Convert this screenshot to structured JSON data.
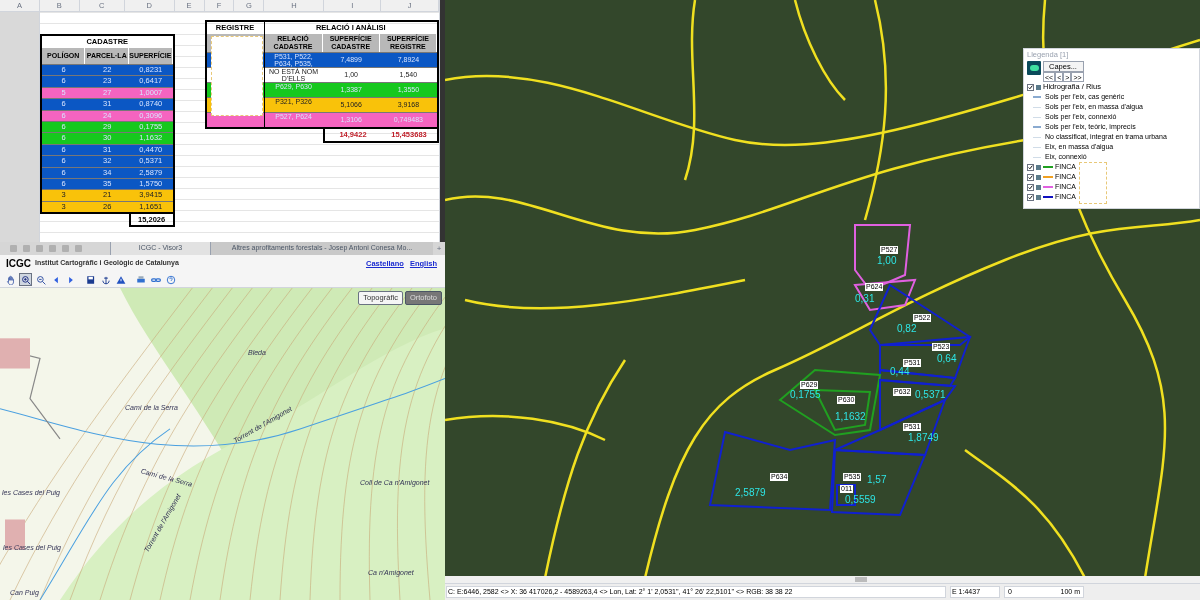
{
  "spreadsheet": {
    "columns": [
      "A",
      "B",
      "C",
      "D",
      "E",
      "F",
      "G",
      "H",
      "I",
      "J"
    ],
    "cadastre": {
      "title": "CADASTRE",
      "headers": [
        "POLÍGON",
        "PARCEL·LA",
        "SUPERFÍCIE"
      ],
      "rows": [
        {
          "poligon": "6",
          "parcela": "22",
          "superficie": "0,8231",
          "color": "#0b57c4"
        },
        {
          "poligon": "6",
          "parcela": "23",
          "superficie": "0,6417",
          "color": "#0b57c4"
        },
        {
          "poligon": "5",
          "parcela": "27",
          "superficie": "1,0007",
          "color": "#f564c0"
        },
        {
          "poligon": "6",
          "parcela": "31",
          "superficie": "0,8740",
          "color": "#0b57c4"
        },
        {
          "poligon": "6",
          "parcela": "24",
          "superficie": "0,3096",
          "color": "#f564c0"
        },
        {
          "poligon": "6",
          "parcela": "29",
          "superficie": "0,1755",
          "color": "#16c81e"
        },
        {
          "poligon": "6",
          "parcela": "30",
          "superficie": "1,1632",
          "color": "#16c81e"
        },
        {
          "poligon": "6",
          "parcela": "31",
          "superficie": "0,4470",
          "color": "#0b57c4"
        },
        {
          "poligon": "6",
          "parcela": "32",
          "superficie": "0,5371",
          "color": "#0b57c4"
        },
        {
          "poligon": "6",
          "parcela": "34",
          "superficie": "2,5879",
          "color": "#0b57c4"
        },
        {
          "poligon": "6",
          "parcela": "35",
          "superficie": "1,5750",
          "color": "#0b57c4"
        },
        {
          "poligon": "3",
          "parcela": "21",
          "superficie": "3,9415",
          "color": "#f9c20a"
        },
        {
          "poligon": "3",
          "parcela": "26",
          "superficie": "1,1651",
          "color": "#f9c20a"
        }
      ],
      "total": "15,2026"
    },
    "registre": {
      "title": "REGISTRE"
    },
    "relacio": {
      "title": "RELACIÓ I ANÀLISI",
      "headers": [
        "RELACIÓ CADASTRE",
        "SUPERFÍCIE CADASTRE",
        "SUPERFÍCIE REGISTRE"
      ],
      "rows": [
        {
          "relacio": "P531, P522, P634, P535,",
          "cadastre": "7,4899",
          "registre": "7,8924",
          "color": "#0b57c4"
        },
        {
          "relacio": "NO ESTÀ NOM D'ELLS",
          "cadastre": "1,00",
          "registre": "1,540",
          "color": "#ffffff"
        },
        {
          "relacio": "P629, P630",
          "cadastre": "1,3387",
          "registre": "1,3550",
          "color": "#16c81e"
        },
        {
          "relacio": "P321, P326",
          "cadastre": "5,1066",
          "registre": "3,9168",
          "color": "#f9c20a"
        },
        {
          "relacio": "P527, P624",
          "cadastre": "1,3106",
          "registre": "0,749483",
          "color": "#f564c0"
        }
      ],
      "totals": [
        "14,9422",
        "15,453683"
      ]
    }
  },
  "browser": {
    "tabs": [
      {
        "label": "ICGC - Visor3",
        "selected": true
      },
      {
        "label": "Altres aprofitaments forestals - Josep Antoni Conesa Mo...",
        "selected": false
      }
    ],
    "new_tab": "+",
    "site": {
      "logo": "ICGC",
      "name": "Institut Cartogràfic i Geològic de Catalunya",
      "links": [
        "Castellano",
        "English"
      ]
    },
    "toolbar": [
      {
        "selected": false
      },
      {
        "selected": true
      },
      {
        "selected": false
      },
      {
        "selected": false
      },
      {
        "selected": false
      },
      {
        "selected": false
      },
      {
        "selected": false
      },
      {
        "selected": false
      },
      {
        "selected": false
      },
      {
        "selected": false
      },
      {
        "selected": false
      }
    ],
    "map_modes": [
      {
        "label": "Topogràfic",
        "selected": true
      },
      {
        "label": "Ortofoto",
        "selected": false
      }
    ],
    "map_labels": [
      "Bleda",
      "Torrent de l'Amigonet",
      "Camí de la Serra",
      "Camí de la Serra",
      "Torrent de l'Amigonet",
      "Coll de Ca n'Amigonet",
      "Ca n'Amigonet",
      "les Cases del Puig",
      "les Cases del Puig",
      "Can Puig"
    ]
  },
  "gis": {
    "parcels": [
      {
        "code": "P527",
        "area": "1,00",
        "color": "#e060e0"
      },
      {
        "code": "P624",
        "area": "0,31",
        "color": "#e060e0"
      },
      {
        "code": "P522",
        "area": "0,82",
        "color": "#1020d0"
      },
      {
        "code": "P523",
        "area": "0,64",
        "color": "#1020d0"
      },
      {
        "code": "P531",
        "area": "0,44",
        "color": "#1020d0"
      },
      {
        "code": "P629",
        "area": "0,1755",
        "color": "#20a020"
      },
      {
        "code": "P630",
        "area": "1,1632",
        "color": "#20a020"
      },
      {
        "code": "P632",
        "area": "0,5371",
        "color": "#1020d0"
      },
      {
        "code": "P531",
        "area": "1,8749",
        "color": "#1020d0"
      },
      {
        "code": "P634",
        "area": "2,5879",
        "color": "#1020d0"
      },
      {
        "code": "P535",
        "area": "1,57",
        "color": "#1020d0"
      },
      {
        "code": "011",
        "area": "0,5559",
        "color": "#1020d0"
      }
    ],
    "legend": {
      "title": "Llegenda [1]",
      "layers_button": "Capes...",
      "nav": [
        "<<",
        "<",
        ">",
        ">>"
      ],
      "layer": {
        "name": "Hidrografia / Rius",
        "checked": true
      },
      "entries": [
        "Sols per l'eix, cas genèric",
        "Sols per l'eix, en massa d'aigua",
        "Sols per l'eix, connexió",
        "Sols per l'eix, teòric, imprecís",
        "No classificat, integrat en trama urbana",
        "Eix, en massa d'aigua",
        "Eix, connexió"
      ],
      "fincas": [
        {
          "label": "FINCA",
          "color": "#20a020",
          "checked": true
        },
        {
          "label": "FINCA",
          "color": "#f0a020",
          "checked": true
        },
        {
          "label": "FINCA",
          "color": "#e060e0",
          "checked": true
        },
        {
          "label": "FINCA",
          "color": "#1010c0",
          "checked": true
        }
      ]
    },
    "status": {
      "coords": "C: E:6446, 2582 <> X: 36 417026,2 - 4589263,4 <> Lon, Lat: 2° 1' 2,0531'', 41° 26' 22,5101'' <> RGB: 38 38 22",
      "scale": "E 1:4437",
      "scale_start": "0",
      "scale_end": "100 m"
    }
  }
}
